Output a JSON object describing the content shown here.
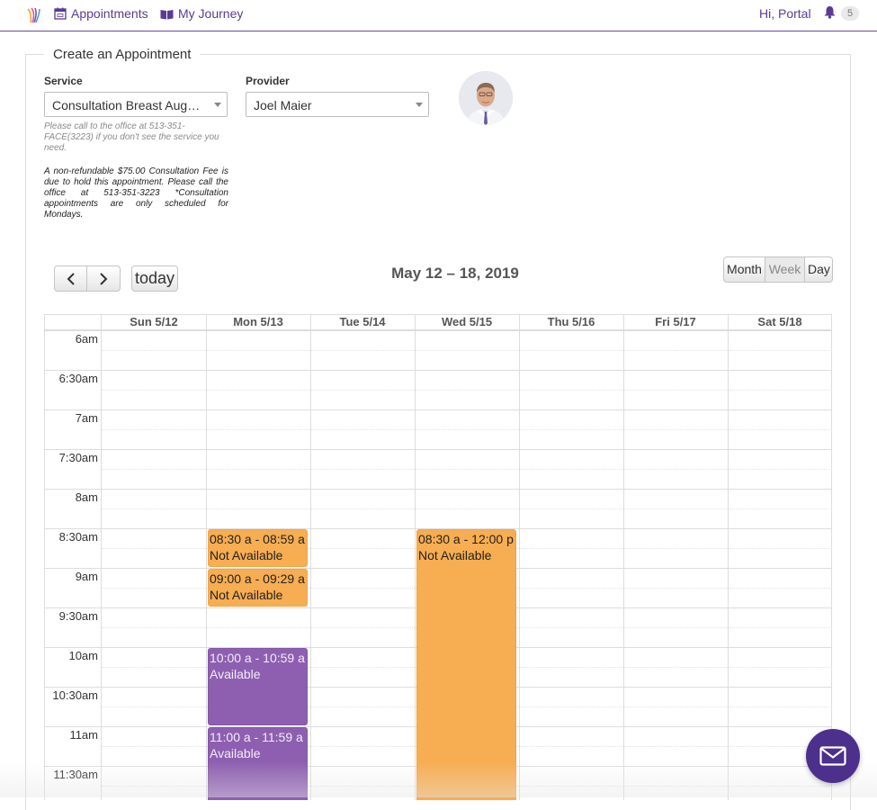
{
  "nav": {
    "appointments_label": "Appointments",
    "journey_label": "My Journey",
    "greeting": "Hi, Portal",
    "notification_count": "5",
    "accent_color": "#5b3a93"
  },
  "form": {
    "legend": "Create an Appointment",
    "service_label": "Service",
    "service_value": "Consultation Breast Augmentation",
    "provider_label": "Provider",
    "provider_value": "Joel Maier",
    "hint": "Please call to the office at 513-351-FACE(3223) if you don't see the service you need.",
    "notice": "A non-refundable $75.00 Consultation Fee is due to hold this appointment. Please call the office at 513-351-3223 *Consultation appointments are only scheduled for Mondays."
  },
  "calendar": {
    "title": "May 12 – 18, 2019",
    "today_label": "today",
    "views": [
      "Month",
      "Week",
      "Day"
    ],
    "active_view": "Week",
    "days": [
      "Sun 5/12",
      "Mon 5/13",
      "Tue 5/14",
      "Wed 5/15",
      "Thu 5/16",
      "Fri 5/17",
      "Sat 5/18"
    ],
    "times": [
      "6am",
      "6:30am",
      "7am",
      "7:30am",
      "8am",
      "8:30am",
      "9am",
      "9:30am",
      "10am",
      "10:30am",
      "11am",
      "11:30am"
    ],
    "events": [
      {
        "day": 1,
        "start": 8.5,
        "end": 9.0,
        "time": "08:30 a - 08:59 a",
        "label": "Not Available",
        "status": "na"
      },
      {
        "day": 1,
        "start": 9.0,
        "end": 9.5,
        "time": "09:00 a - 09:29 a",
        "label": "Not Available",
        "status": "na"
      },
      {
        "day": 1,
        "start": 10.0,
        "end": 11.0,
        "time": "10:00 a - 10:59 a",
        "label": "Available",
        "status": "av"
      },
      {
        "day": 1,
        "start": 11.0,
        "end": 12.0,
        "time": "11:00 a - 11:59 a",
        "label": "Available",
        "status": "av"
      },
      {
        "day": 3,
        "start": 8.5,
        "end": 12.0,
        "time": "08:30 a - 12:00 p",
        "label": "Not Available",
        "status": "na"
      }
    ],
    "colors": {
      "not_available": "#f7ad52",
      "available": "#8e5fb0"
    }
  }
}
